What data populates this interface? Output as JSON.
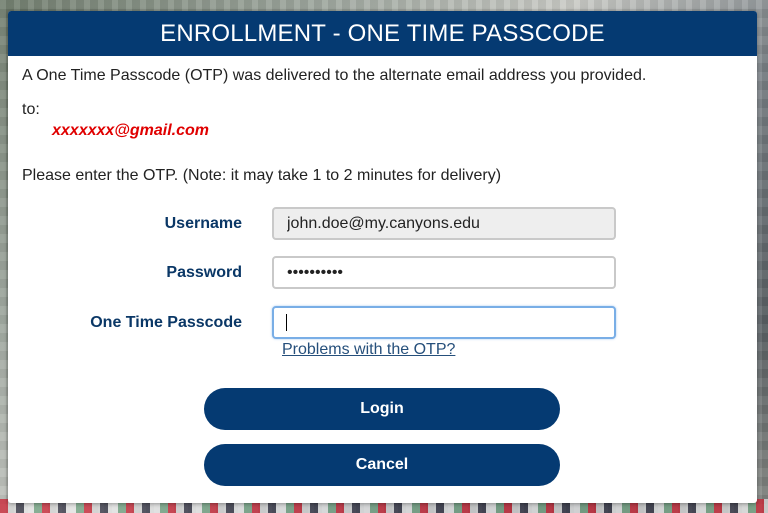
{
  "dialog": {
    "title": "ENROLLMENT - ONE TIME PASSCODE",
    "delivery_message": "A One Time Passcode (OTP) was delivered to the alternate email address you provided.",
    "to_label": "to:",
    "masked_email": "xxxxxxx@gmail.com",
    "instructions": "Please enter the OTP. (Note: it may take 1 to 2 minutes for delivery)"
  },
  "form": {
    "username_label": "Username",
    "username_value": "john.doe@my.canyons.edu",
    "password_label": "Password",
    "password_value": "••••••••••",
    "otp_label": "One Time Passcode",
    "otp_value": "",
    "help_link": "Problems with the OTP?"
  },
  "buttons": {
    "login": "Login",
    "cancel": "Cancel"
  },
  "colors": {
    "primary": "#053a72",
    "email_highlight": "#e00000",
    "focus_border": "#79aee6"
  }
}
